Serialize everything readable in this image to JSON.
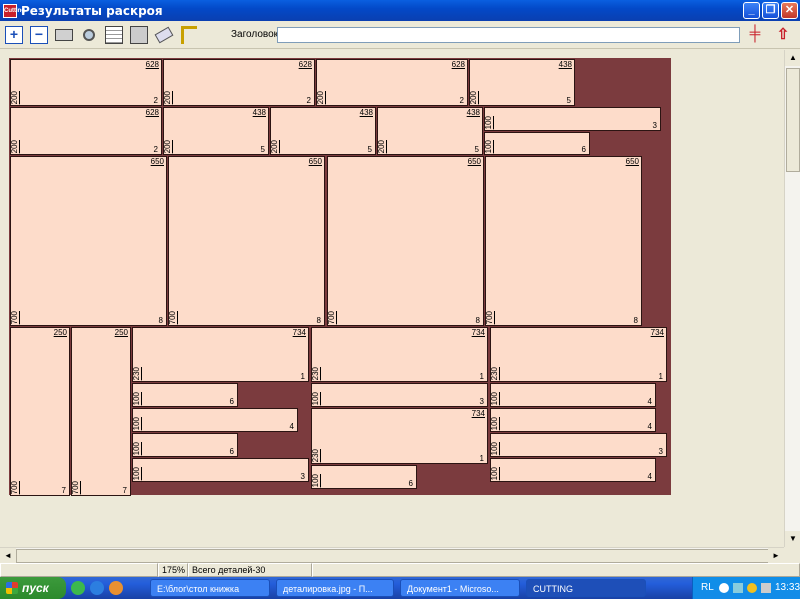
{
  "window": {
    "title": "Результаты раскроя",
    "app_icon": "Cutting",
    "minimize": "_",
    "maximize": "❐",
    "close": "✕"
  },
  "toolbar": {
    "header_label": "Заголовок",
    "header_value": "",
    "icons": [
      "zoom-in-icon",
      "zoom-out-icon",
      "print-icon",
      "magnifier-icon",
      "calendar-icon",
      "print-preview-icon",
      "eraser-icon",
      "measure-icon"
    ],
    "right_icons": [
      "saw-icon",
      "exit-icon"
    ]
  },
  "pieces": [
    {
      "w": "628",
      "h": "200",
      "q": "2"
    },
    {
      "w": "628",
      "h": "200",
      "q": "2"
    },
    {
      "w": "628",
      "h": "200",
      "q": "2"
    },
    {
      "w": "438",
      "h": "200",
      "q": "5"
    },
    {
      "w": "628",
      "h": "200",
      "q": "2"
    },
    {
      "w": "438",
      "h": "200",
      "q": "5"
    },
    {
      "w": "438",
      "h": "200",
      "q": "5"
    },
    {
      "w": "438",
      "h": "200",
      "q": "5"
    },
    {
      "w": "",
      "h": "100",
      "q": "3"
    },
    {
      "w": "",
      "h": "100",
      "q": "6"
    },
    {
      "w": "650",
      "h": "700",
      "q": "8"
    },
    {
      "w": "650",
      "h": "700",
      "q": "8"
    },
    {
      "w": "650",
      "h": "700",
      "q": "8"
    },
    {
      "w": "650",
      "h": "700",
      "q": "8"
    },
    {
      "w": "250",
      "h": "700",
      "q": "7"
    },
    {
      "w": "250",
      "h": "700",
      "q": "7"
    },
    {
      "w": "734",
      "h": "230",
      "q": "1"
    },
    {
      "w": "734",
      "h": "230",
      "q": "1"
    },
    {
      "w": "734",
      "h": "230",
      "q": "1"
    },
    {
      "w": "",
      "h": "100",
      "q": "6"
    },
    {
      "w": "",
      "h": "100",
      "q": "3"
    },
    {
      "w": "",
      "h": "100",
      "q": "4"
    },
    {
      "w": "",
      "h": "100",
      "q": "4"
    },
    {
      "w": "734",
      "h": "230",
      "q": "1"
    },
    {
      "w": "",
      "h": "100",
      "q": "4"
    },
    {
      "w": "",
      "h": "100",
      "q": "6"
    },
    {
      "w": "",
      "h": "100",
      "q": "3"
    },
    {
      "w": "",
      "h": "100",
      "q": "3"
    },
    {
      "w": "",
      "h": "100",
      "q": "6"
    },
    {
      "w": "",
      "h": "100",
      "q": "4"
    }
  ],
  "colors": {
    "waste": "#7b3b3e",
    "piece": "#fddcca"
  },
  "status": {
    "zoom": "175%",
    "total": "Всего деталей-30"
  },
  "taskbar": {
    "start": "пуск",
    "buttons": [
      {
        "label": "E:\\блог\\стол книжка"
      },
      {
        "label": "деталировка.jpg - П..."
      },
      {
        "label": "Документ1 - Microso..."
      },
      {
        "label": "CUTTING"
      }
    ],
    "lang": "RL",
    "clock": "13:33"
  }
}
